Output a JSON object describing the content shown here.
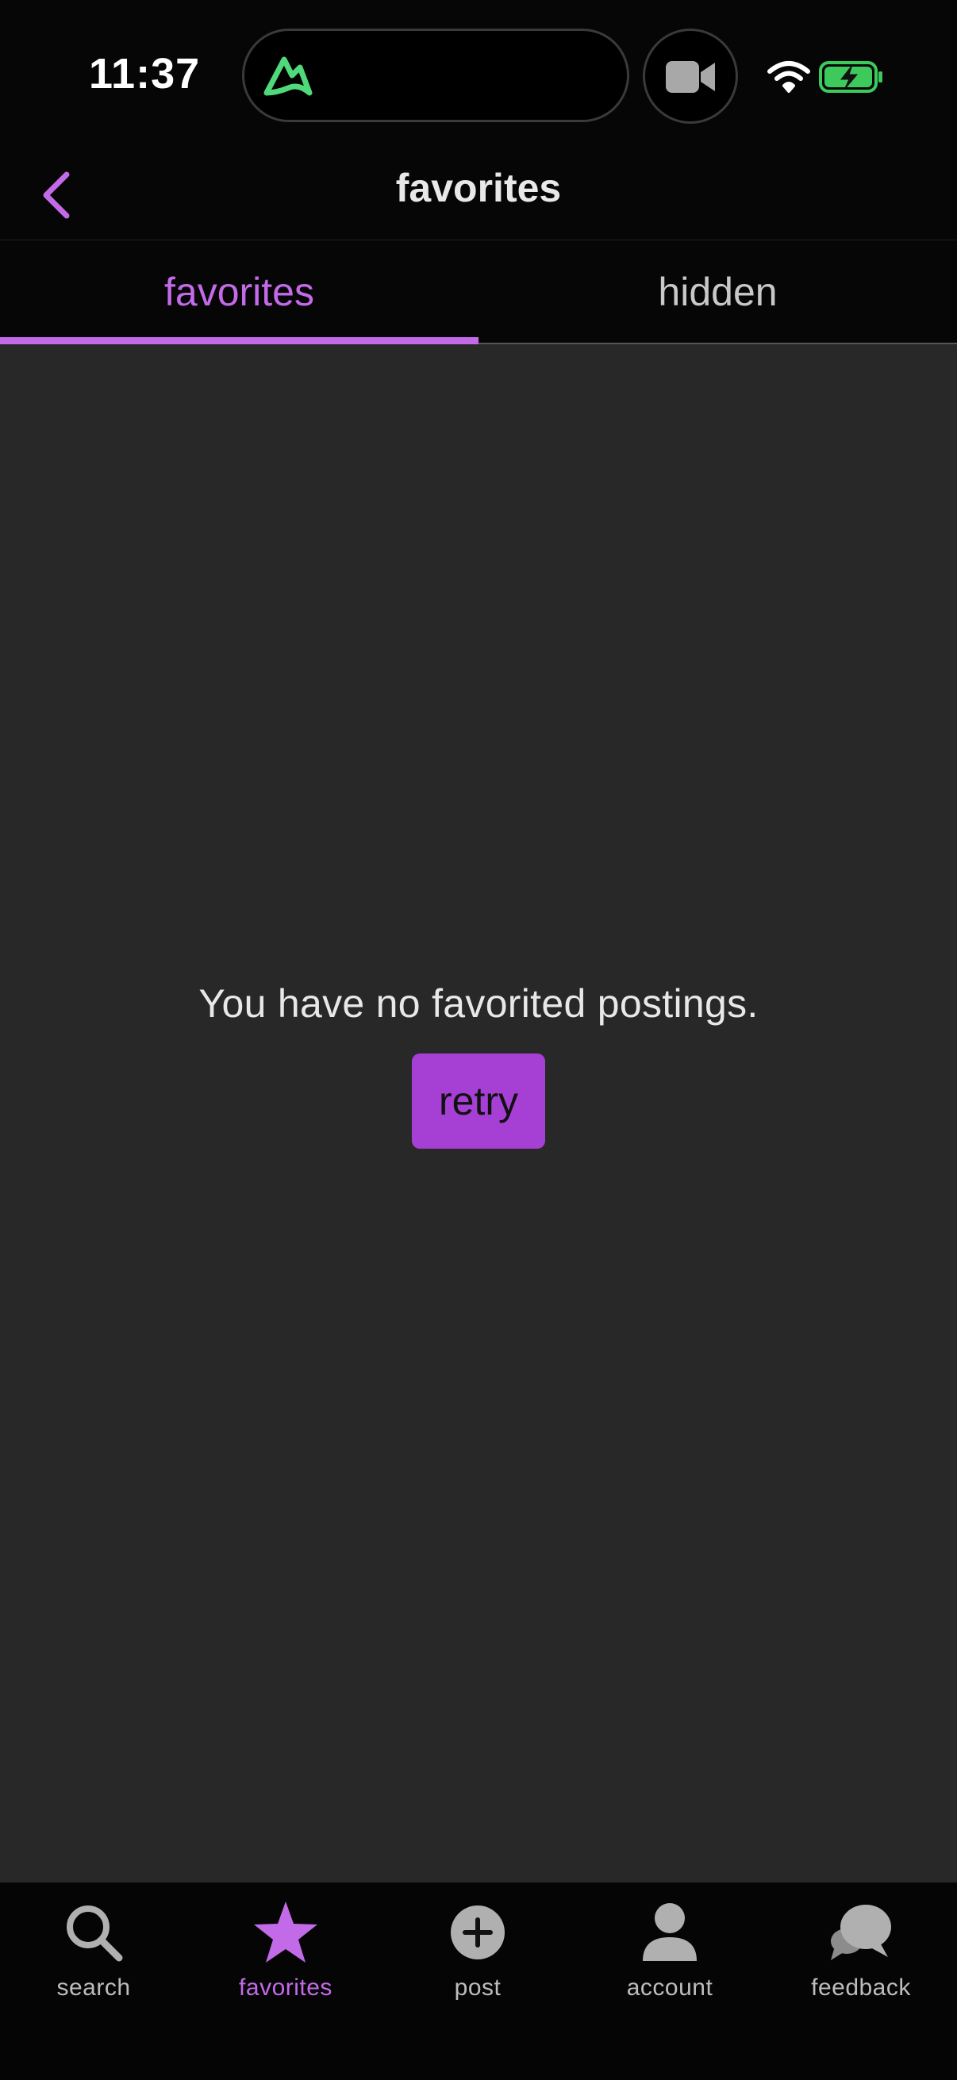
{
  "status_bar": {
    "time": "11:37"
  },
  "header": {
    "title": "favorites"
  },
  "tabs": [
    {
      "label": "favorites",
      "active": true
    },
    {
      "label": "hidden",
      "active": false
    }
  ],
  "main": {
    "empty_message": "You have no favorited postings.",
    "retry_label": "retry"
  },
  "tab_bar": {
    "items": [
      {
        "label": "search",
        "icon": "search-icon",
        "active": false
      },
      {
        "label": "favorites",
        "icon": "star-icon",
        "active": true
      },
      {
        "label": "post",
        "icon": "plus-circle-icon",
        "active": false
      },
      {
        "label": "account",
        "icon": "person-icon",
        "active": false
      },
      {
        "label": "feedback",
        "icon": "chat-bubbles-icon",
        "active": false
      }
    ]
  },
  "colors": {
    "accent": "#c36ae8",
    "button": "#a63fd4",
    "content_background": "#282828",
    "bar_background": "#060606",
    "island_icon": "#4fd97a",
    "battery_fill": "#3ec95c"
  }
}
